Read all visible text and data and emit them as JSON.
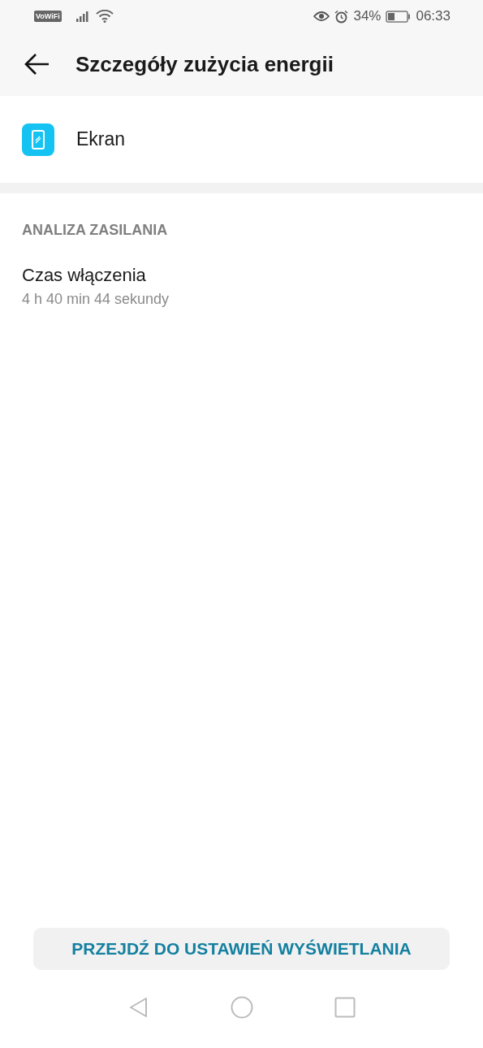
{
  "status_bar": {
    "vowifi": "VoWiFi",
    "battery": "34%",
    "time": "06:33"
  },
  "header": {
    "title": "Szczegóły zużycia energii"
  },
  "app": {
    "name": "Ekran"
  },
  "section": {
    "title": "ANALIZA ZASILANIA",
    "items": [
      {
        "title": "Czas włączenia",
        "value": "4 h 40 min 44 sekundy"
      }
    ]
  },
  "action_button": "PRZEJDŹ DO USTAWIEŃ WYŚWIETLANIA"
}
